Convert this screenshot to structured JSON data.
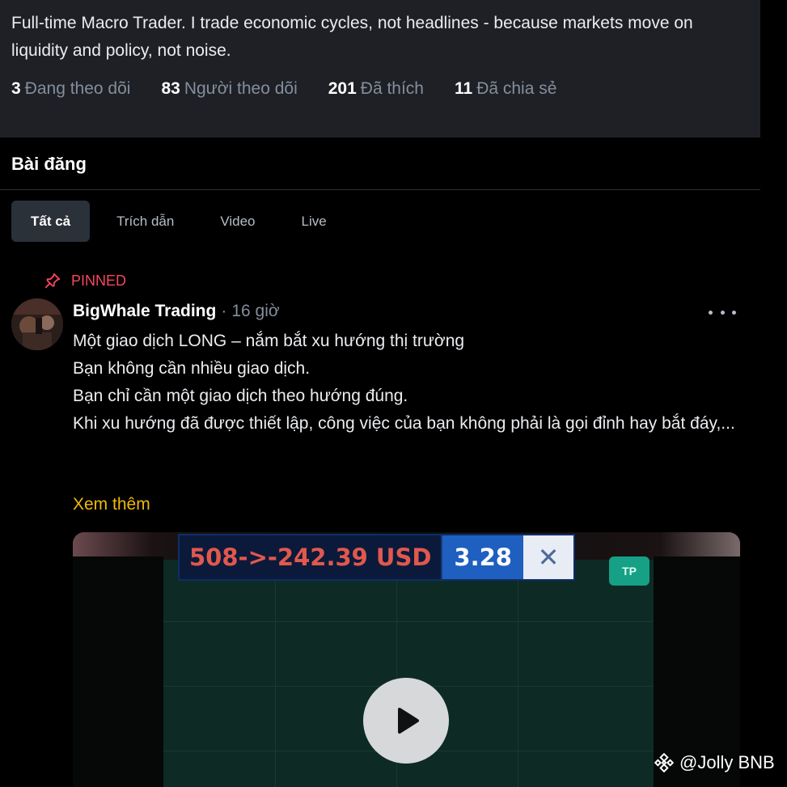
{
  "profile": {
    "bio": "Full-time Macro Trader. I trade economic cycles, not headlines - because markets move on liquidity and policy, not noise.",
    "stats": [
      {
        "num": "3",
        "label": "Đang theo dõi"
      },
      {
        "num": "83",
        "label": "Người theo dõi"
      },
      {
        "num": "201",
        "label": "Đã thích"
      },
      {
        "num": "11",
        "label": "Đã chia sẻ"
      }
    ]
  },
  "section": {
    "title": "Bài đăng"
  },
  "tabs": [
    {
      "label": "Tất cả",
      "active": true
    },
    {
      "label": "Trích dẫn",
      "active": false
    },
    {
      "label": "Video",
      "active": false
    },
    {
      "label": "Live",
      "active": false
    }
  ],
  "post": {
    "pinned_label": "PINNED",
    "author": "BigWhale Trading",
    "separator": "·",
    "time": "16 giờ",
    "lines": [
      "Một giao dịch LONG – nắm bắt xu hướng thị trường",
      "Bạn không cần nhiều giao dịch.",
      "",
      "Bạn chỉ cần một giao dịch theo hướng đúng.",
      "Khi xu hướng đã được thiết lập, công việc của bạn không phải là gọi đỉnh hay bắt đáy,..."
    ],
    "see_more": "Xem thêm",
    "video": {
      "pnl_text": "508->-242.39 USD",
      "value_text": "3.28",
      "close_symbol": "✕",
      "tp_label": "TP"
    }
  },
  "watermark": {
    "text": "@Jolly BNB"
  },
  "colors": {
    "accent": "#f0b90b",
    "pinned": "#f6465d",
    "panel": "#1e2026"
  },
  "icons": {
    "pin": "pin-icon",
    "more": "more-icon",
    "play": "play-icon",
    "logo": "binance-logo-icon"
  }
}
